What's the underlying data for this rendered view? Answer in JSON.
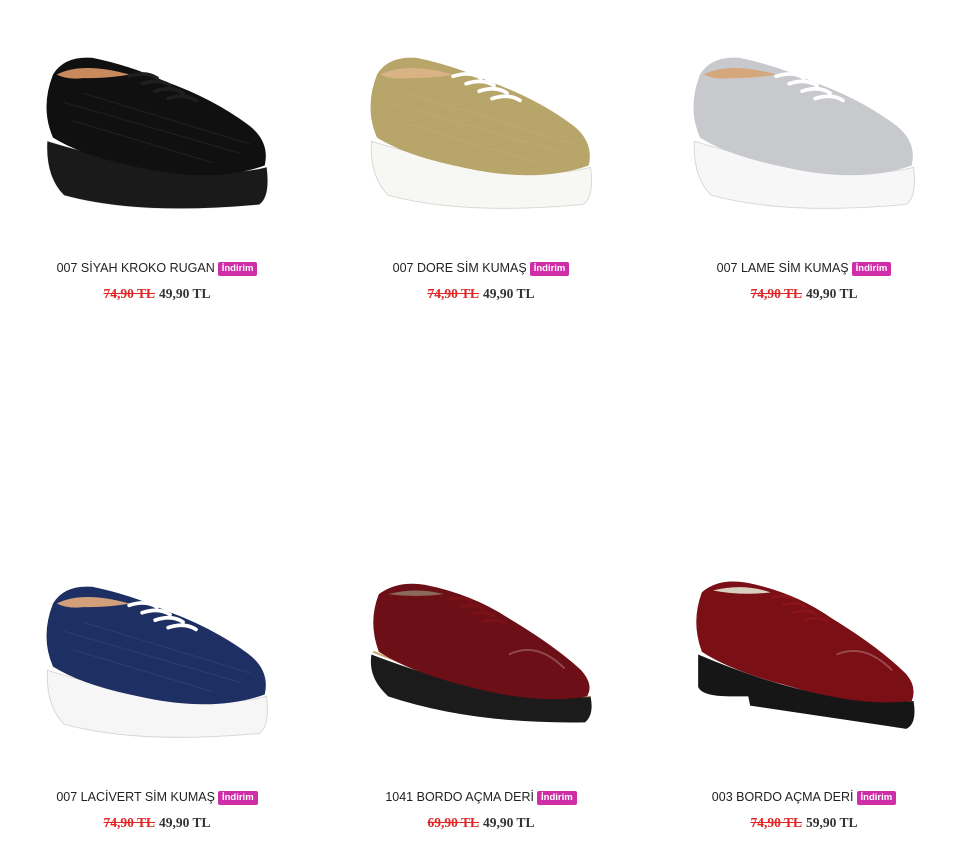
{
  "products": [
    {
      "name": "007 SİYAH KROKO RUGAN",
      "badge": "İndirim",
      "old_price": "74,90 TL",
      "price": "49,90 TL",
      "upper": "#101010",
      "sole": "#1a1a1a",
      "lace": "#1e1e1e",
      "lining": "#c8895c"
    },
    {
      "name": "007 DORE SİM KUMAŞ",
      "badge": "İndirim",
      "old_price": "74,90 TL",
      "price": "49,90 TL",
      "upper": "#b8a56a",
      "sole": "#f7f7f4",
      "lace": "#ffffff",
      "lining": "#d9b384"
    },
    {
      "name": "007 LAME SİM KUMAŞ",
      "badge": "İndirim",
      "old_price": "74,90 TL",
      "price": "49,90 TL",
      "upper": "#c7c9cc",
      "sole": "#f7f7f7",
      "lace": "#ffffff",
      "lining": "#d5a77c"
    },
    {
      "name": "007 LACİVERT SİM KUMAŞ",
      "badge": "İndirim",
      "old_price": "74,90 TL",
      "price": "49,90 TL",
      "upper": "#1e2f63",
      "sole": "#f6f6f6",
      "lace": "#ffffff",
      "lining": "#d1a07a"
    },
    {
      "name": "1041 BORDO AÇMA DERİ",
      "badge": "İndirim",
      "old_price": "69,90 TL",
      "price": "49,90 TL",
      "upper": "#6d0f16",
      "sole": "#1b1b1b",
      "lace": "#7a1218",
      "lining": "#8a6a5a"
    },
    {
      "name": "003 BORDO AÇMA DERİ",
      "badge": "İndirim",
      "old_price": "74,90 TL",
      "price": "59,90 TL",
      "upper": "#7a0f15",
      "sole": "#161616",
      "lace": "#8a141a",
      "lining": "#d9cfc1"
    }
  ]
}
